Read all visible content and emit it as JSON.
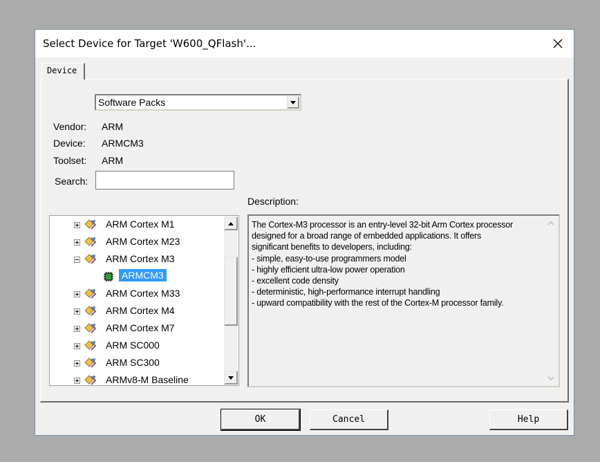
{
  "window": {
    "title": "Select Device for Target 'W600_QFlash'..."
  },
  "tabs": [
    {
      "label": "Device"
    }
  ],
  "source_select": {
    "value": "Software Packs"
  },
  "info": {
    "vendor_label": "Vendor:",
    "vendor_value": "ARM",
    "device_label": "Device:",
    "device_value": "ARMCM3",
    "toolset_label": "Toolset:",
    "toolset_value": "ARM",
    "search_label": "Search:",
    "search_value": ""
  },
  "tree": {
    "items": [
      {
        "label": "ARM Cortex M1",
        "expanded": false,
        "icon": "device-family-icon"
      },
      {
        "label": "ARM Cortex M23",
        "expanded": false,
        "icon": "device-family-icon"
      },
      {
        "label": "ARM Cortex M3",
        "expanded": true,
        "icon": "device-family-icon"
      },
      {
        "label": "ARMCM3",
        "selected": true,
        "icon": "chip-icon"
      },
      {
        "label": "ARM Cortex M33",
        "expanded": false,
        "icon": "device-family-icon"
      },
      {
        "label": "ARM Cortex M4",
        "expanded": false,
        "icon": "device-family-icon"
      },
      {
        "label": "ARM Cortex M7",
        "expanded": false,
        "icon": "device-family-icon"
      },
      {
        "label": "ARM SC000",
        "expanded": false,
        "icon": "device-family-icon"
      },
      {
        "label": "ARM SC300",
        "expanded": false,
        "icon": "device-family-icon"
      },
      {
        "label": "ARMv8-M Baseline",
        "expanded": false,
        "icon": "device-family-icon"
      }
    ]
  },
  "description": {
    "label": "Description:",
    "lines": [
      "The Cortex-M3 processor is an entry-level 32-bit Arm Cortex processor",
      "designed for a broad range of embedded applications. It offers",
      "significant benefits to developers, including:",
      "- simple, easy-to-use programmers model",
      "- highly efficient ultra-low power operation",
      "- excellent code density",
      "- deterministic, high-performance interrupt handling",
      "- upward compatibility with the rest of the Cortex-M processor family."
    ]
  },
  "buttons": {
    "ok": "OK",
    "cancel": "Cancel",
    "help": "Help"
  },
  "colors": {
    "selection": "#3399ff",
    "dialog_bg": "#f0f0f0",
    "desktop_bg": "#ababab"
  }
}
